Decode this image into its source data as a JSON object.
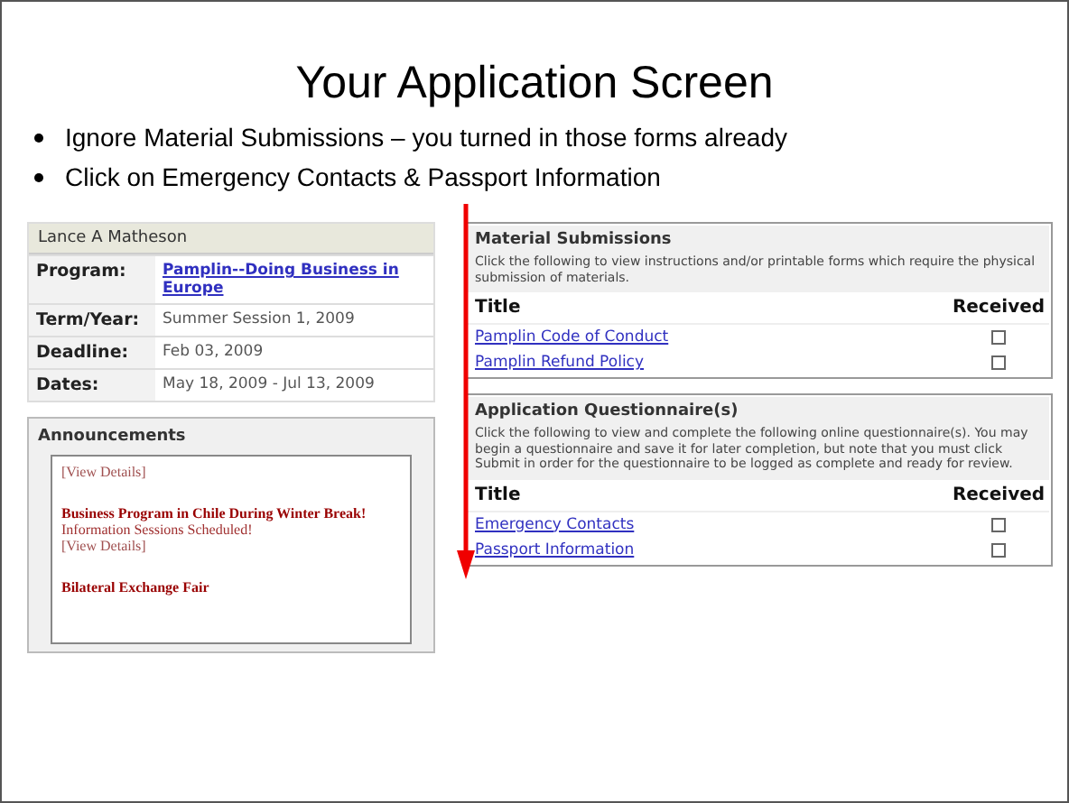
{
  "slide": {
    "title": "Your Application Screen",
    "bullets": [
      "Ignore Material Submissions – you turned in those forms already",
      "Click on Emergency Contacts & Passport Information"
    ]
  },
  "profile": {
    "name": "Lance A Matheson",
    "fields": [
      {
        "label": "Program:",
        "value": "Pamplin--Doing Business in Europe",
        "kind": "link"
      },
      {
        "label": "Term/Year:",
        "value": "Summer Session 1, 2009",
        "kind": "text"
      },
      {
        "label": "Deadline:",
        "value": "Feb 03, 2009",
        "kind": "text"
      },
      {
        "label": "Dates:",
        "value": "May 18, 2009 - Jul 13, 2009",
        "kind": "text"
      }
    ]
  },
  "announcements": {
    "title": "Announcements",
    "items": [
      {
        "text": "[View Details]",
        "kind": "link"
      },
      {
        "text": "Business Program in Chile During Winter Break!",
        "kind": "headline"
      },
      {
        "text": "Information Sessions Scheduled!",
        "kind": "note"
      },
      {
        "text": "[View Details]",
        "kind": "link"
      },
      {
        "text": "Bilateral Exchange Fair",
        "kind": "headline"
      }
    ]
  },
  "sections": [
    {
      "title": "Material Submissions",
      "intro": "Click the following to view instructions and/or printable forms which require the physical submission of materials.",
      "columns": [
        "Title",
        "Received"
      ],
      "rows": [
        {
          "title": "Pamplin Code of Conduct",
          "received": false
        },
        {
          "title": "Pamplin Refund Policy",
          "received": false
        }
      ]
    },
    {
      "title": "Application Questionnaire(s)",
      "intro": "Click the following to view and complete the following online questionnaire(s). You may begin a questionnaire and save it for later completion, but note that you must click Submit in order for the questionnaire to be logged as complete and ready for review.",
      "columns": [
        "Title",
        "Received"
      ],
      "rows": [
        {
          "title": "Emergency Contacts",
          "received": false
        },
        {
          "title": "Passport Information",
          "received": false
        }
      ]
    }
  ]
}
